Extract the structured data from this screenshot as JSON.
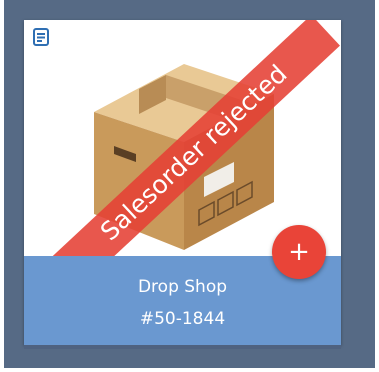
{
  "card": {
    "title": "Drop Shop",
    "subtitle": "#50-1844",
    "status_ribbon": "Salesorder rejected",
    "add_button_label": "+"
  },
  "icons": {
    "document": "document-icon",
    "product_image": "cardboard-box-image",
    "add": "plus-icon"
  },
  "colors": {
    "background": "#566a85",
    "card_footer": "#6a98d0",
    "ribbon": "#e54034",
    "fab": "#e94438",
    "doc_icon": "#2f6fb3"
  }
}
